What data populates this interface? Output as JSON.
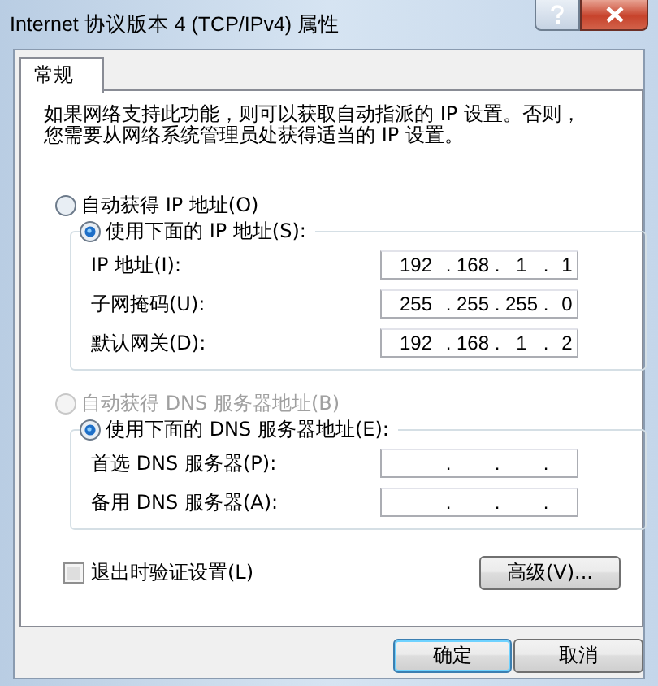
{
  "window": {
    "title": "Internet 协议版本 4 (TCP/IPv4) 属性"
  },
  "tabs": [
    {
      "label": "常规",
      "selected": true
    }
  ],
  "description_lines": [
    "如果网络支持此功能，则可以获取自动指派的 IP 设置。否则，",
    "您需要从网络系统管理员处获得适当的 IP 设置。"
  ],
  "ip_auto": {
    "label": "自动获得 IP 地址(O)",
    "selected": false,
    "disabled": false
  },
  "ip_manual": {
    "label": "使用下面的 IP 地址(S):",
    "selected": true,
    "disabled": false,
    "fields": [
      {
        "label": "IP 地址(I):",
        "octets": [
          "192",
          "168",
          "1",
          "1"
        ],
        "dots": [
          ".",
          ".",
          "."
        ]
      },
      {
        "label": "子网掩码(U):",
        "octets": [
          "255",
          "255",
          "255",
          "0"
        ],
        "dots": [
          ".",
          ".",
          "."
        ]
      },
      {
        "label": "默认网关(D):",
        "octets": [
          "192",
          "168",
          "1",
          "2"
        ],
        "dots": [
          ".",
          ".",
          "."
        ]
      }
    ]
  },
  "dns_auto": {
    "label": "自动获得 DNS 服务器地址(B)",
    "selected": false,
    "disabled": true
  },
  "dns_manual": {
    "label": "使用下面的 DNS 服务器地址(E):",
    "selected": true,
    "disabled": false,
    "fields": [
      {
        "label": "首选 DNS 服务器(P):",
        "dots": [
          ".",
          ".",
          "."
        ]
      },
      {
        "label": "备用 DNS 服务器(A):",
        "dots": [
          ".",
          ".",
          "."
        ]
      }
    ]
  },
  "validate_on_exit": {
    "label": "退出时验证设置(L)",
    "checked": false
  },
  "advanced_button": "高级(V)...",
  "buttons": [
    {
      "label": "确定",
      "default": true
    },
    {
      "label": "取消",
      "default": false
    }
  ]
}
